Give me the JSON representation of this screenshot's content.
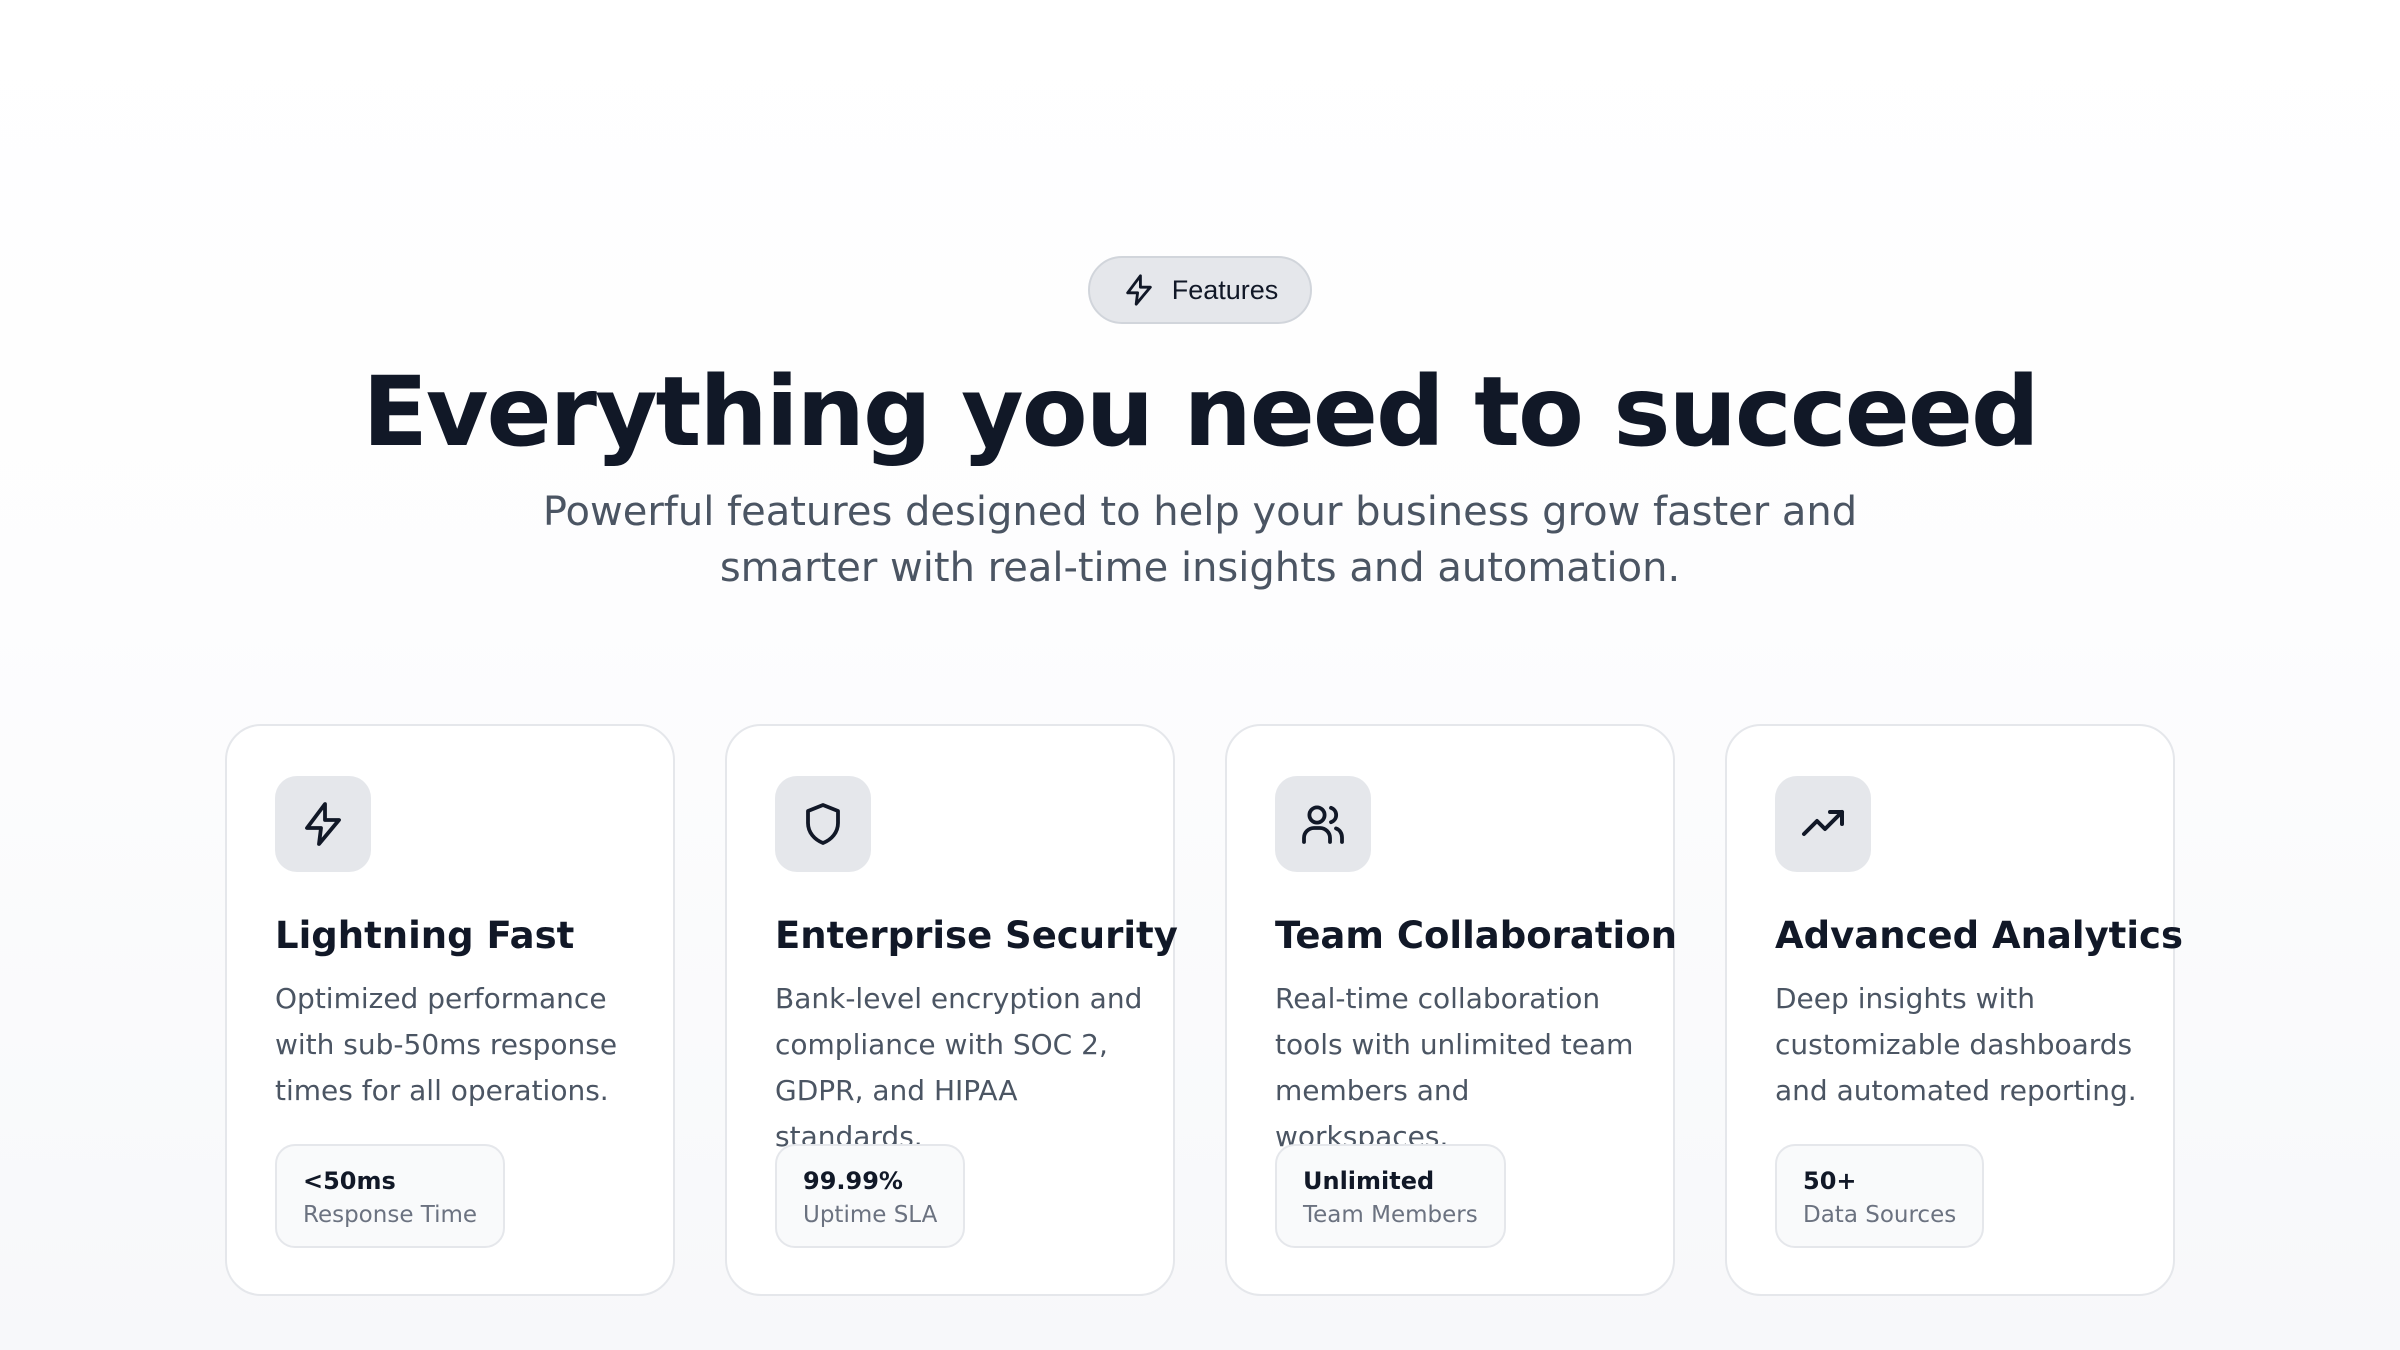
{
  "badge": {
    "label": "Features",
    "icon": "lightning-icon"
  },
  "heading": "Everything you need to succeed",
  "subheading": "Powerful features designed to help your business grow faster and smarter with real-time insights and automation.",
  "colors": {
    "text_primary": "#111827",
    "text_secondary": "#4b5563",
    "icon_bg": "#e5e7eb",
    "card_border": "#e5e7eb"
  },
  "cards": [
    {
      "icon": "lightning-icon",
      "title": "Lightning Fast",
      "description": "Optimized performance with sub-50ms response times for all operations.",
      "stat_value": "<50ms",
      "stat_label": "Response Time"
    },
    {
      "icon": "shield-icon",
      "title": "Enterprise Security",
      "description": "Bank-level encryption and compliance with SOC 2, GDPR, and HIPAA standards.",
      "stat_value": "99.99%",
      "stat_label": "Uptime SLA"
    },
    {
      "icon": "users-icon",
      "title": "Team Collaboration",
      "description": "Real-time collaboration tools with unlimited team members and workspaces.",
      "stat_value": "Unlimited",
      "stat_label": "Team Members"
    },
    {
      "icon": "trending-up-icon",
      "title": "Advanced Analytics",
      "description": "Deep insights with customizable dashboards and automated reporting.",
      "stat_value": "50+",
      "stat_label": "Data Sources"
    }
  ]
}
